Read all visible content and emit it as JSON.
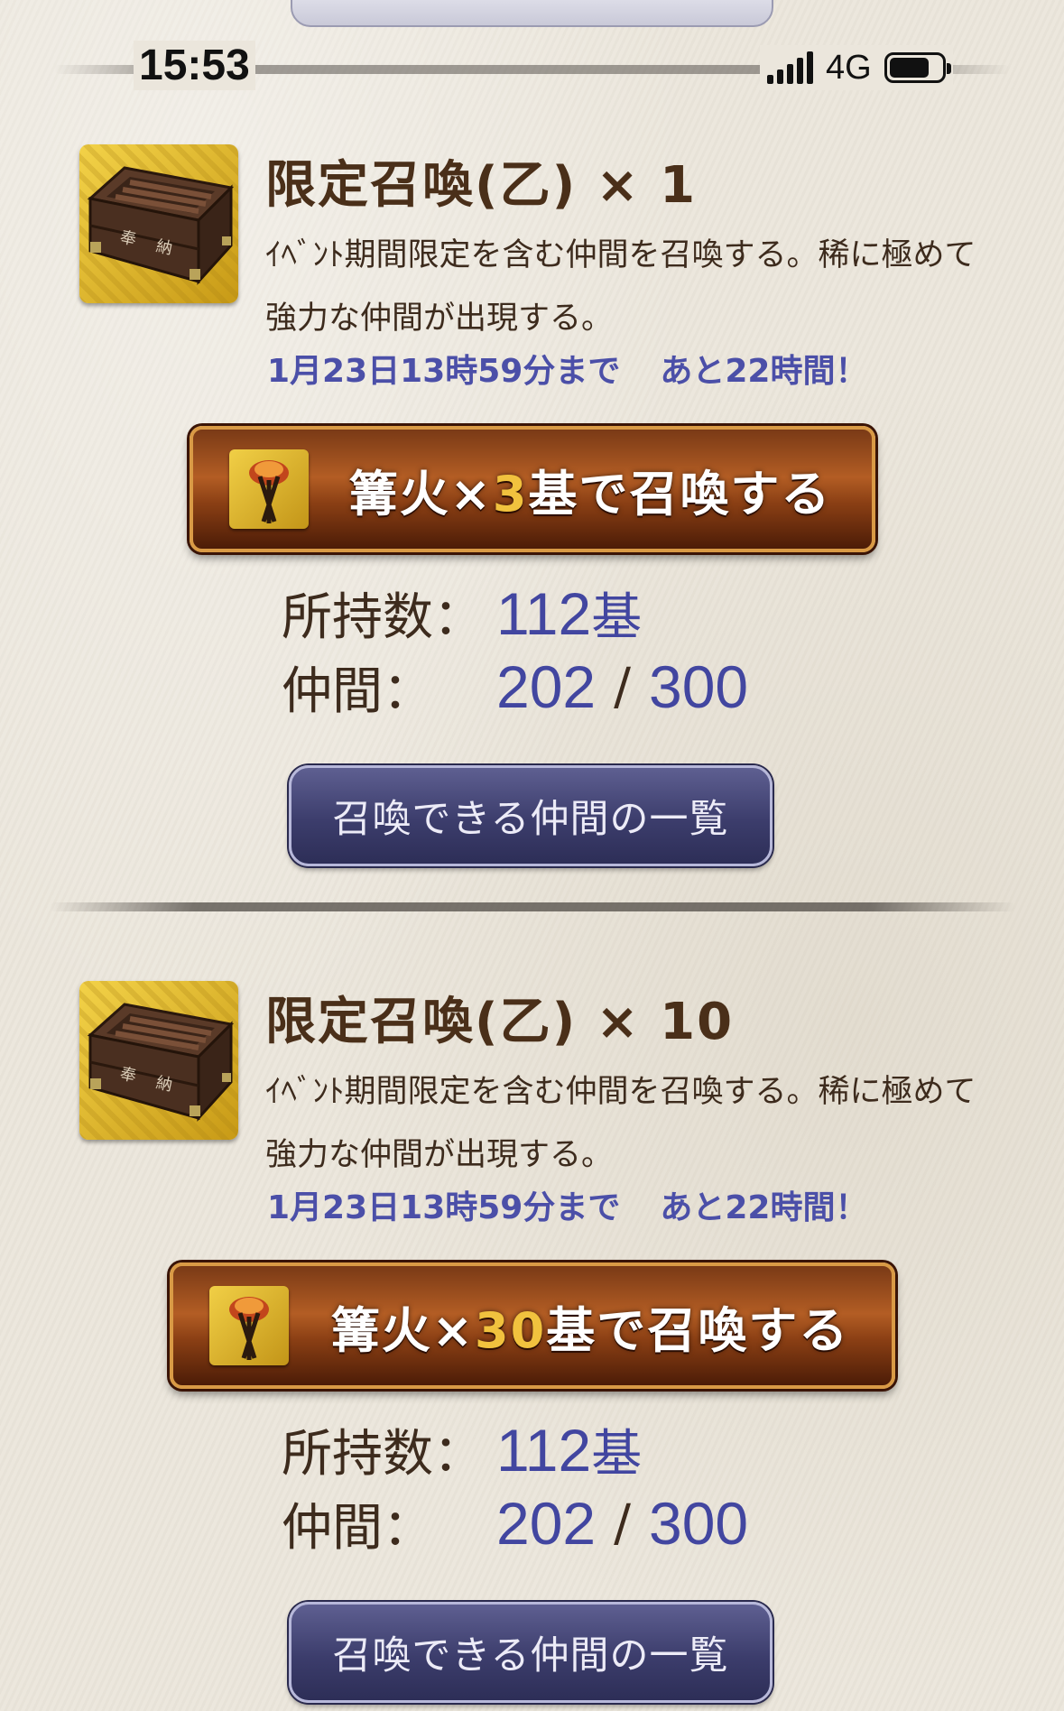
{
  "status_bar": {
    "time": "15:53",
    "network": "4G"
  },
  "sections": [
    {
      "title": "限定召喚(乙) × 1",
      "description": "ｲﾍﾞﾝﾄ期間限定を含む仲間を召喚する。稀に極めて強力な仲間が出現する。",
      "deadline": "1月23日13時59分まで",
      "remaining": "あと22時間！",
      "summon_button": {
        "prefix": "篝火×",
        "count": "3",
        "suffix": "基で召喚する"
      },
      "owned_label": "所持数：",
      "owned_value": "112",
      "owned_unit": "基",
      "members_label": "仲間：",
      "members_current": "202",
      "members_max": "300",
      "list_button": "召喚できる仲間の一覧"
    },
    {
      "title": "限定召喚(乙) × 10",
      "description": "ｲﾍﾞﾝﾄ期間限定を含む仲間を召喚する。稀に極めて強力な仲間が出現する。",
      "deadline": "1月23日13時59分まで",
      "remaining": "あと22時間！",
      "summon_button": {
        "prefix": "篝火×",
        "count": "30",
        "suffix": "基で召喚する"
      },
      "owned_label": "所持数：",
      "owned_value": "112",
      "owned_unit": "基",
      "members_label": "仲間：",
      "members_current": "202",
      "members_max": "300",
      "list_button": "召喚できる仲間の一覧"
    }
  ],
  "icons": {
    "item": "wooden-chest-icon",
    "summon": "bonfire-icon"
  },
  "colors": {
    "accent_blue": "#4246a0",
    "summon_button": "#8a3f14",
    "highlight_number": "#f1c23e"
  }
}
